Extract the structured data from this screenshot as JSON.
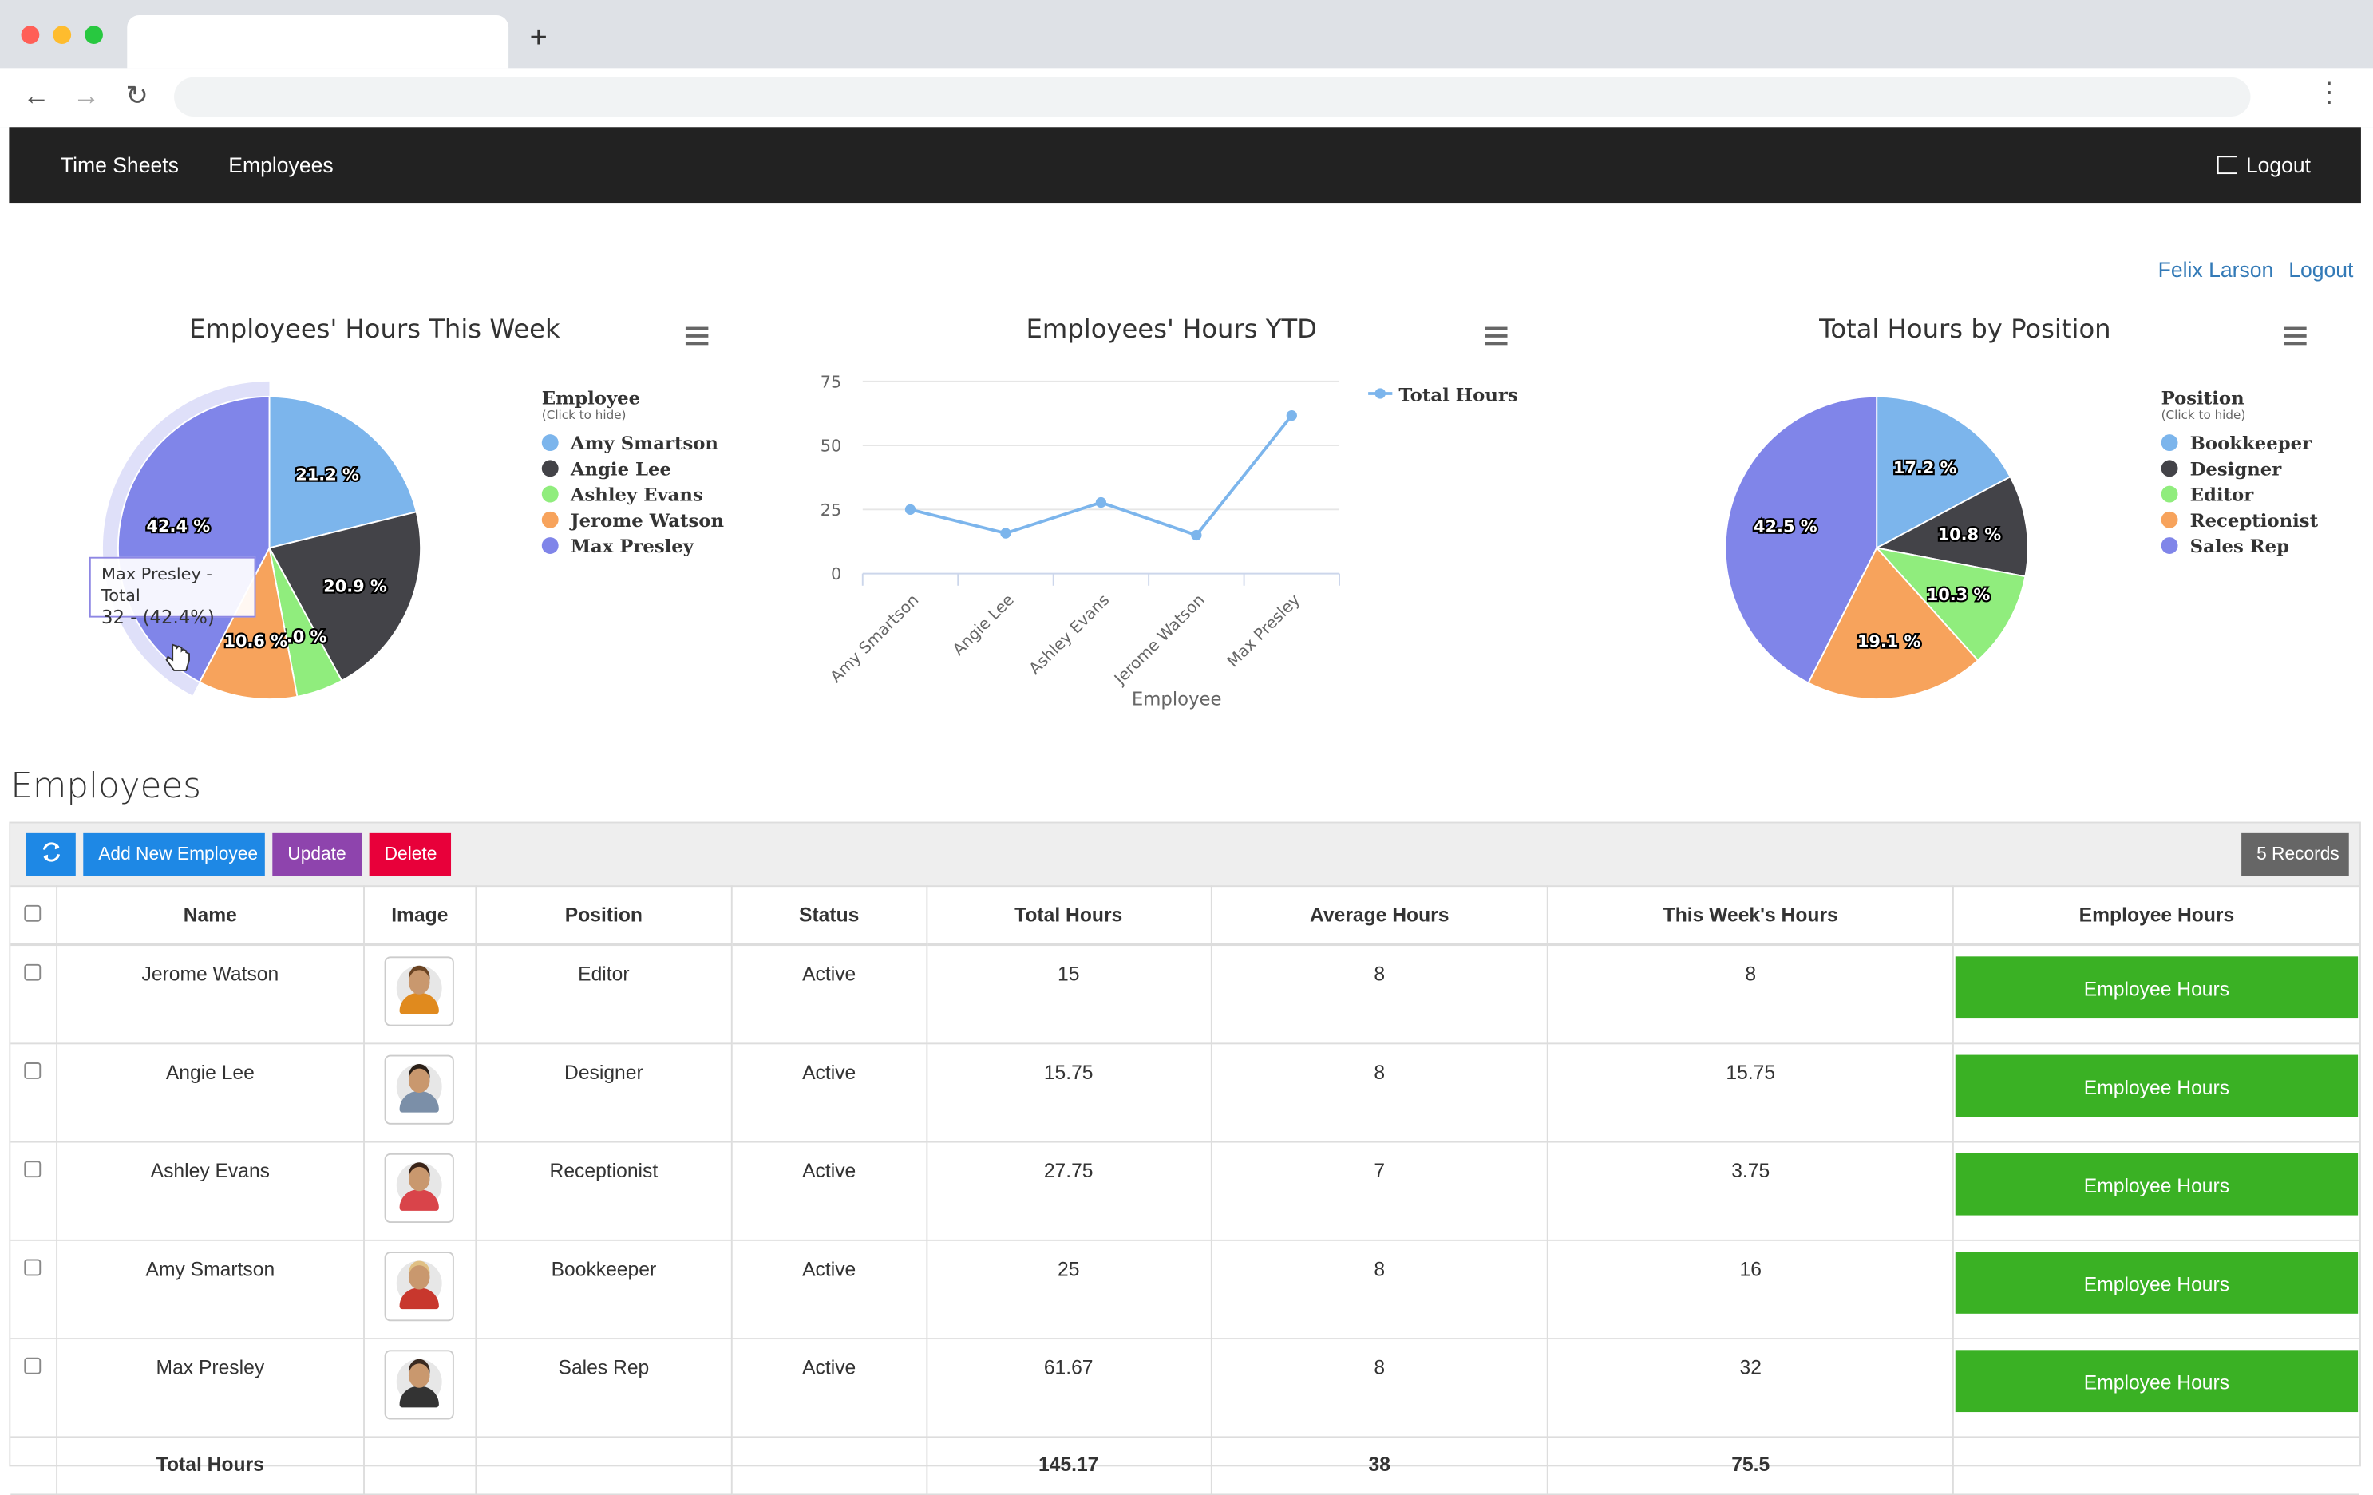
{
  "app_nav": {
    "time_sheets": "Time Sheets",
    "employees": "Employees",
    "logout": "Logout"
  },
  "user": {
    "name": "Felix Larson",
    "logout": "Logout"
  },
  "charts": {
    "week": {
      "title": "Employees' Hours This Week",
      "legend_title": "Employee",
      "legend_hint": "(Click to hide)",
      "tooltip_line1": "Max Presley - Total",
      "tooltip_line2": "32 - (42.4%)"
    },
    "ytd": {
      "title": "Employees' Hours YTD",
      "legend": "Total Hours",
      "xlabel": "Employee"
    },
    "position": {
      "title": "Total Hours by Position",
      "legend_title": "Position",
      "legend_hint": "(Click to hide)"
    }
  },
  "chart_data": [
    {
      "type": "pie",
      "title": "Employees' Hours This Week",
      "labels": [
        "Amy Smartson",
        "Angie Lee",
        "Ashley Evans",
        "Jerome Watson",
        "Max Presley"
      ],
      "values": [
        21.2,
        20.9,
        5.0,
        10.6,
        42.4
      ],
      "data_labels": [
        "21.2 %",
        "20.9 %",
        "5.0 %",
        "10.6 %",
        "42.4 %"
      ],
      "colors": [
        "#7cb5ec",
        "#434348",
        "#90ed7d",
        "#f7a35c",
        "#8085e9"
      ]
    },
    {
      "type": "line",
      "title": "Employees' Hours YTD",
      "categories": [
        "Amy Smartson",
        "Angie Lee",
        "Ashley Evans",
        "Jerome Watson",
        "Max Presley"
      ],
      "series": [
        {
          "name": "Total Hours",
          "values": [
            25,
            15.75,
            27.75,
            15,
            61.67
          ]
        }
      ],
      "xlabel": "Employee",
      "ylabel": "",
      "ylim": [
        0,
        75
      ],
      "yticks": [
        0,
        25,
        50,
        75
      ],
      "color": "#7cb5ec"
    },
    {
      "type": "pie",
      "title": "Total Hours by Position",
      "labels": [
        "Bookkeeper",
        "Designer",
        "Editor",
        "Receptionist",
        "Sales Rep"
      ],
      "values": [
        17.2,
        10.8,
        10.3,
        19.1,
        42.5
      ],
      "data_labels": [
        "17.2 %",
        "10.8 %",
        "10.3 %",
        "19.1 %",
        "42.5 %"
      ],
      "colors": [
        "#7cb5ec",
        "#434348",
        "#90ed7d",
        "#f7a35c",
        "#8085e9"
      ]
    }
  ],
  "employees": {
    "section_title": "Employees",
    "toolbar": {
      "add": "Add New Employee",
      "update": "Update",
      "delete": "Delete",
      "records": "5 Records"
    },
    "columns": [
      "Name",
      "Image",
      "Position",
      "Status",
      "Total Hours",
      "Average Hours",
      "This Week's Hours",
      "Employee Hours"
    ],
    "rows": [
      {
        "name": "Jerome Watson",
        "position": "Editor",
        "status": "Active",
        "total": "15",
        "avg": "8",
        "week": "8",
        "button": "Employee Hours"
      },
      {
        "name": "Angie Lee",
        "position": "Designer",
        "status": "Active",
        "total": "15.75",
        "avg": "8",
        "week": "15.75",
        "button": "Employee Hours"
      },
      {
        "name": "Ashley Evans",
        "position": "Receptionist",
        "status": "Active",
        "total": "27.75",
        "avg": "7",
        "week": "3.75",
        "button": "Employee Hours"
      },
      {
        "name": "Amy Smartson",
        "position": "Bookkeeper",
        "status": "Active",
        "total": "25",
        "avg": "8",
        "week": "16",
        "button": "Employee Hours"
      },
      {
        "name": "Max Presley",
        "position": "Sales Rep",
        "status": "Active",
        "total": "61.67",
        "avg": "8",
        "week": "32",
        "button": "Employee Hours"
      }
    ],
    "totals": {
      "label": "Total Hours",
      "total": "145.17",
      "avg": "38",
      "week": "75.5"
    }
  }
}
